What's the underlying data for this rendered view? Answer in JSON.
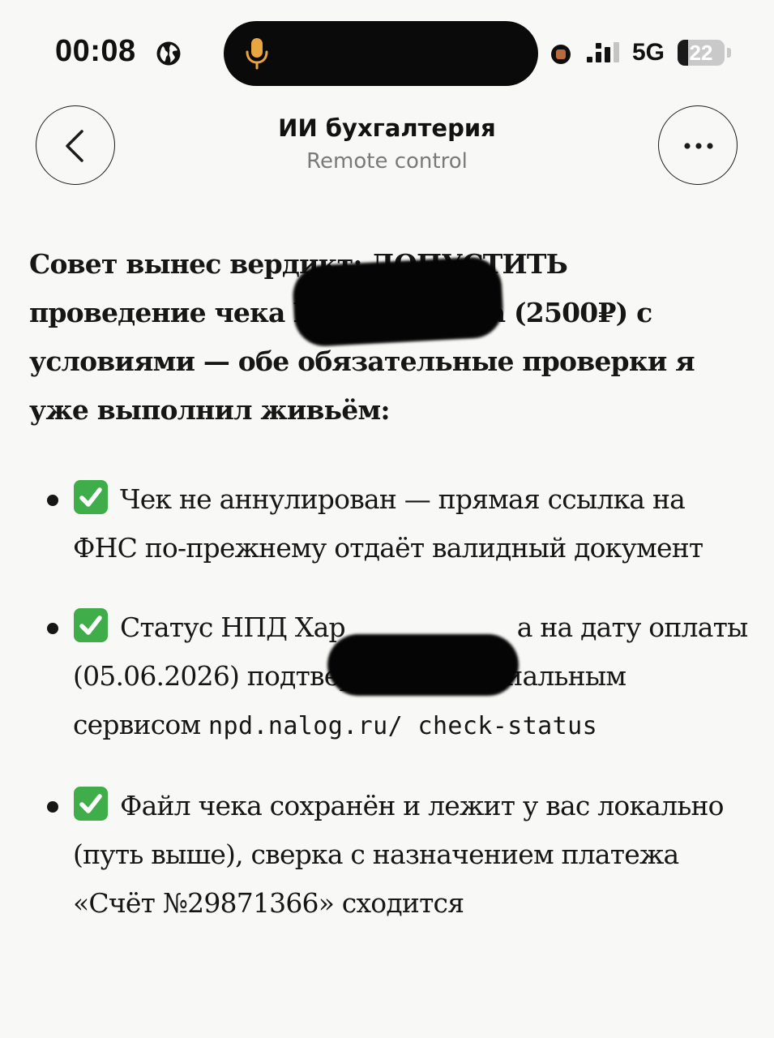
{
  "status_bar": {
    "time": "00:08",
    "network": "5G",
    "battery_percent": 22,
    "battery_label": "22",
    "icons": [
      "globe-icon",
      "microphone-icon",
      "recording-indicator",
      "signal-icon",
      "battery-icon"
    ],
    "accent_colors": {
      "microphone": "#e8a640",
      "recording": "#b86a3c"
    }
  },
  "header": {
    "title": "ИИ бухгалтерия",
    "subtitle": "Remote control",
    "back_icon": "chevron-left-icon",
    "more_icon": "ellipsis-icon"
  },
  "message": {
    "intro_1": "Совет вынес вердикт: ДОПУСТИТЬ",
    "intro_2": "проведение чека Ха",
    "intro_2_tail": "а (2500₽) с",
    "intro_3": "условиями — обе обязательные проверки я уже выполнил живьём:",
    "items": [
      {
        "check_icon": "green-checkmark-icon",
        "text": "Чек не аннулирован — прямая ссылка на ФНС по-прежнему отдаёт валидный документ"
      },
      {
        "check_icon": "green-checkmark-icon",
        "text_a": "Статус НПД Хар",
        "text_b": "а на дату",
        "text_c": "оплаты (05.06.2026) подтверждён официальным сервисом",
        "code": "npd.nalog.ru/ check-status"
      },
      {
        "check_icon": "green-checkmark-icon",
        "text": "Файл чека сохранён и лежит у вас локально (путь выше), сверка с назначением платежа «Счёт №29871366» сходится"
      }
    ],
    "check_color": "#3fae4a"
  }
}
